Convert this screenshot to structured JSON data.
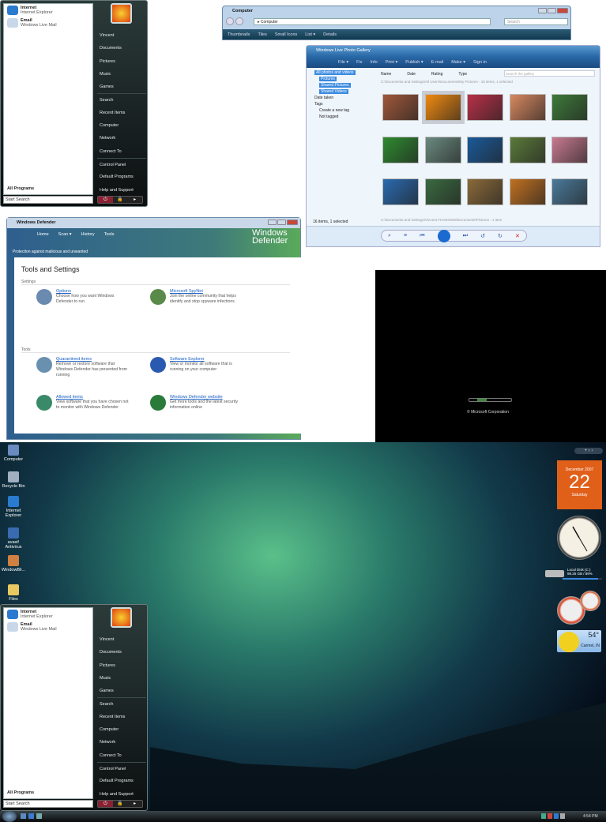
{
  "start_menu": {
    "pinned": [
      {
        "title": "Internet",
        "subtitle": "Internet Explorer",
        "icon": "internet-explorer-icon"
      },
      {
        "title": "Email",
        "subtitle": "Windows Live Mail",
        "icon": "mail-icon"
      }
    ],
    "all_programs": "All Programs",
    "search_placeholder": "Start Search",
    "right_items": [
      "Vincent",
      "Documents",
      "Pictures",
      "Music",
      "Games",
      "Search",
      "Recent Items",
      "Computer",
      "Network",
      "Connect To",
      "Control Panel",
      "Default Programs",
      "Help and Support"
    ],
    "power_glyphs": [
      "⏻",
      "🔒",
      "▸"
    ]
  },
  "computer_window": {
    "title": "Computer",
    "address": "▸ Computer",
    "search_placeholder": "Search",
    "toolbar": [
      "Thumbnails",
      "Tiles",
      "Small Icons",
      "List ▾",
      "Details"
    ]
  },
  "photo_gallery": {
    "title": "Windows Live Photo Gallery",
    "toolbar": [
      "File ▾",
      "Fix",
      "Info",
      "Print ▾",
      "Publish ▾",
      "E-mail",
      "Make ▾",
      "Sign in"
    ],
    "tree": [
      "All photos and videos",
      "Pictures",
      "Shared Pictures",
      "Shared Videos",
      "Date taken",
      "Tags",
      "Create a new tag",
      "Not tagged"
    ],
    "columns": [
      "Name",
      "Date",
      "Rating",
      "Type"
    ],
    "search_placeholder": "Search the gallery",
    "path_header": "C:\\Documents and Settings\\All Users\\Documents\\My Pictures - 15 items, 1 selected",
    "path_footer": "C:\\Documents and Settings\\Vincent.THANG000\\Documents\\Pictures - 1 item",
    "status": "16 items, 1 selected",
    "thumb_colors": [
      "#a0583a",
      "#f08a10",
      "#b83048",
      "#d88860",
      "#3d7a3a",
      "#2e8a30",
      "#6a8a80",
      "#1a5a9a",
      "#5a7a3a",
      "#c87a90",
      "#2a6ab0",
      "#3a6a40",
      "#8a6a3a",
      "#c07020",
      "#4a7a9a"
    ],
    "selected_index": 1
  },
  "defender": {
    "title": "Windows Defender",
    "nav": [
      "Home",
      "Scan ▾",
      "History",
      "Tools"
    ],
    "logo": "Windows Defender",
    "tagline": "Protection against malicious and unwanted",
    "heading": "Tools and Settings",
    "sections": [
      {
        "label": "Settings",
        "items": [
          {
            "link": "Options",
            "desc": "Choose how you want Windows Defender to run",
            "color": "#6a8ab0"
          },
          {
            "link": "Microsoft SpyNet",
            "desc": "Join the online community that helps identify and stop spyware infections",
            "color": "#5a8a4a"
          }
        ]
      },
      {
        "label": "Tools",
        "items": [
          {
            "link": "Quarantined items",
            "desc": "Remove or restore software that Windows Defender has prevented from running",
            "color": "#6a90b0"
          },
          {
            "link": "Software Explorer",
            "desc": "View or monitor all software that is running on your computer",
            "color": "#2a5ab0"
          },
          {
            "link": "Allowed items",
            "desc": "View software that you have chosen not to monitor with Windows Defender",
            "color": "#3a8a6a"
          },
          {
            "link": "Windows Defender website",
            "desc": "Get more tools and the latest security information online",
            "color": "#2a7a3a"
          }
        ]
      }
    ]
  },
  "boot": {
    "copyright": "© Microsoft Corporation"
  },
  "desktop": {
    "icons": [
      {
        "label": "Computer",
        "color": "#6a8ac0"
      },
      {
        "label": "Recycle Bin",
        "color": "#a0b0c0"
      },
      {
        "label": "Internet Explorer",
        "color": "#2a7ad0"
      },
      {
        "label": "avast! Antivirus",
        "color": "#3a6ab0"
      },
      {
        "label": "WindowBli...",
        "color": "#d08040"
      },
      {
        "label": "Files",
        "color": "#e8c860"
      }
    ],
    "calendar": {
      "month": "December 2007",
      "day": "22",
      "weekday": "Saturday"
    },
    "disk": {
      "label": "Local Disk (C:)",
      "detail": "98.25 GB / 89%",
      "percent": 89
    },
    "weather": {
      "temp": "54°",
      "city": "Carmel, IN"
    },
    "clock_time": "4:54 PM"
  }
}
